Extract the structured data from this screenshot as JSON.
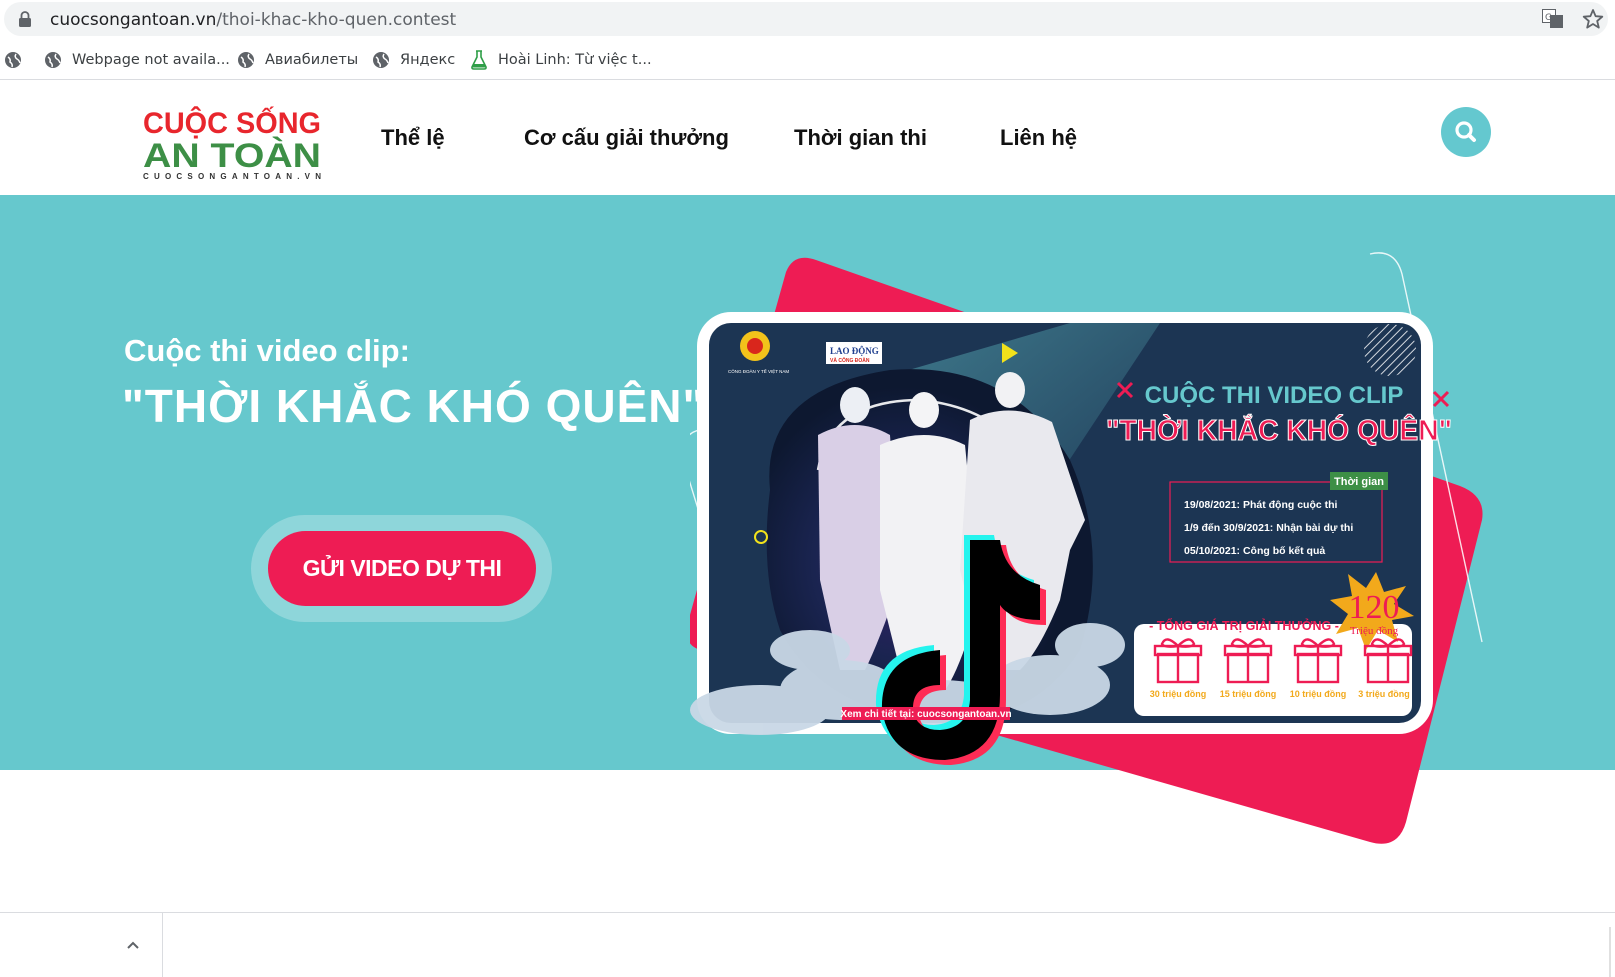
{
  "browser": {
    "url_host": "cuocsongantoan.vn",
    "url_path": "/thoi-khac-kho-quen.contest",
    "bookmarks": [
      {
        "label": "",
        "icon": "globe-icon"
      },
      {
        "label": "Webpage not availa...",
        "icon": "globe-icon"
      },
      {
        "label": "Авиабилеты",
        "icon": "globe-icon"
      },
      {
        "label": "Яндекс",
        "icon": "globe-icon"
      },
      {
        "label": "Hoài Linh: Từ việc t...",
        "icon": "flask-icon"
      }
    ]
  },
  "site": {
    "logo": {
      "line1": "CUỘC SỐNG",
      "line2": "AN TOÀN",
      "domain": "CUOCSONGANTOAN.VN"
    },
    "nav": [
      "Thể lệ",
      "Cơ cấu giải thưởng",
      "Thời gian thi",
      "Liên hệ"
    ]
  },
  "hero": {
    "subtitle": "Cuộc thi video clip:",
    "title": "\"THỜI KHẮC KHÓ QUÊN\"",
    "cta": "GỬI VIDEO DỰ THI"
  },
  "poster": {
    "org_caption": "CÔNG ĐOÀN Y TẾ VIỆT NAM",
    "paper": "LAO ĐỘNG",
    "paper_sub": "VÀ CÔNG ĐOÀN",
    "heading": "CUỘC THI VIDEO CLIP",
    "title": "\"THỜI KHẮC KHÓ QUÊN\"",
    "schedule_label": "Thời gian",
    "schedule": [
      "19/08/2021: Phát động cuộc thi",
      "1/9 đến 30/9/2021: Nhận bài dự thi",
      "05/10/2021: Công bố kết quả"
    ],
    "prize_total_label": "- TỔNG GIÁ TRỊ GIẢI THƯỞNG -",
    "prize_total": "120",
    "prize_unit": "Triệu đồng",
    "prizes": [
      "30 triệu đồng",
      "15 triệu đồng",
      "10 triệu đồng",
      "3 triệu đồng"
    ],
    "footer": "Xem chi tiết tại: cuocsongantoan.vn"
  },
  "colors": {
    "teal": "#66c8cd",
    "pink": "#ee1c54",
    "navy": "#1c3553"
  }
}
